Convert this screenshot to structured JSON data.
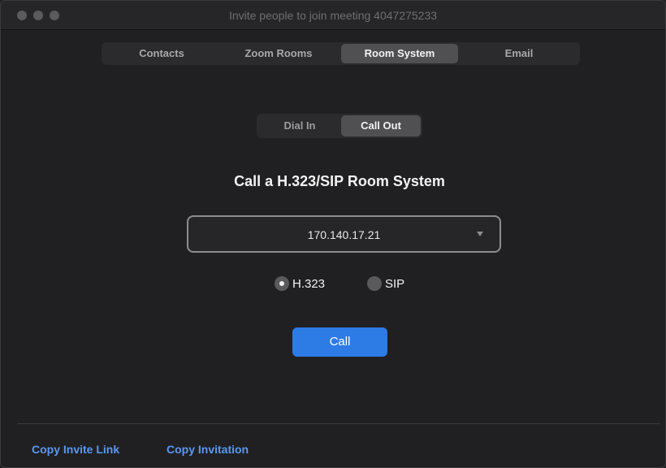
{
  "window": {
    "title": "Invite people to join meeting 4047275233"
  },
  "tabs": [
    {
      "label": "Contacts"
    },
    {
      "label": "Zoom Rooms"
    },
    {
      "label": "Room System",
      "selected": true
    },
    {
      "label": "Email"
    }
  ],
  "mode": {
    "options": [
      {
        "label": "Dial In"
      },
      {
        "label": "Call Out",
        "selected": true
      }
    ]
  },
  "callout": {
    "heading": "Call a H.323/SIP Room System",
    "address_value": "170.140.17.21",
    "protocols": [
      {
        "label": "H.323",
        "selected": true
      },
      {
        "label": "SIP",
        "selected": false
      }
    ],
    "call_label": "Call"
  },
  "footer": {
    "copy_link_label": "Copy Invite Link",
    "copy_invitation_label": "Copy Invitation"
  },
  "colors": {
    "accent": "#2d7be5",
    "link": "#5a98f0",
    "background": "#202022"
  }
}
